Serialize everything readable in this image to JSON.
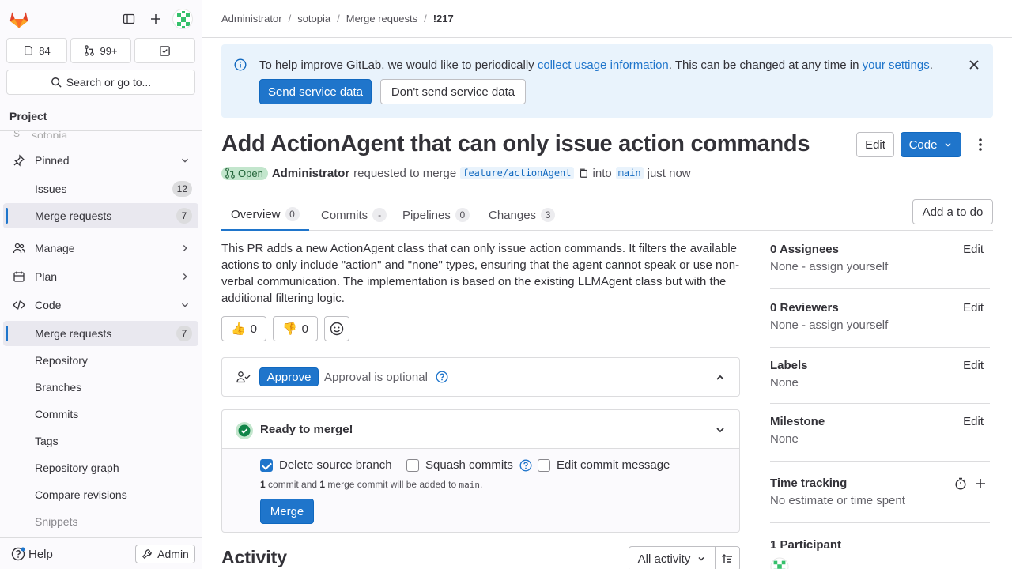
{
  "sidebar": {
    "counts": {
      "issues": "84",
      "merge_requests": "99+"
    },
    "search_label": "Search or go to...",
    "section_title": "Project",
    "project_name": "sotopia",
    "project_initial": "S",
    "pinned": "Pinned",
    "pinned_items": [
      {
        "label": "Issues",
        "badge": "12"
      },
      {
        "label": "Merge requests",
        "badge": "7"
      }
    ],
    "groups": {
      "manage": "Manage",
      "plan": "Plan",
      "code": "Code"
    },
    "code_items": [
      {
        "label": "Merge requests",
        "badge": "7"
      },
      {
        "label": "Repository"
      },
      {
        "label": "Branches"
      },
      {
        "label": "Commits"
      },
      {
        "label": "Tags"
      },
      {
        "label": "Repository graph"
      },
      {
        "label": "Compare revisions"
      },
      {
        "label": "Snippets"
      }
    ],
    "help": "Help",
    "admin": "Admin"
  },
  "breadcrumb": [
    "Administrator",
    "sotopia",
    "Merge requests",
    "!217"
  ],
  "alert": {
    "text_before": "To help improve GitLab, we would like to periodically ",
    "link1": "collect usage information",
    "text_middle": ". This can be changed at any time in ",
    "link2": "your settings",
    "text_after": ".",
    "send": "Send service data",
    "dont_send": "Don't send service data"
  },
  "mr": {
    "title": "Add ActionAgent that can only issue action commands",
    "edit": "Edit",
    "code": "Code",
    "status": "Open",
    "author": "Administrator",
    "requested": "requested to merge",
    "source_branch": "feature/actionAgent",
    "into": "into",
    "target_branch": "main",
    "time": "just now"
  },
  "tabs": [
    {
      "label": "Overview",
      "count": "0"
    },
    {
      "label": "Commits",
      "count": "-"
    },
    {
      "label": "Pipelines",
      "count": "0"
    },
    {
      "label": "Changes",
      "count": "3"
    }
  ],
  "add_todo": "Add a to do",
  "description": "This PR adds a new ActionAgent class that can only issue action commands. It filters the available actions to only include \"action\" and \"none\" types, ensuring that the agent cannot speak or use non-verbal communication. The implementation is based on the existing LLMAgent class but with the additional filtering logic.",
  "reactions": {
    "thumbs_up": "0",
    "thumbs_down": "0"
  },
  "approval": {
    "button": "Approve",
    "text": "Approval is optional"
  },
  "merge": {
    "status": "Ready to merge!",
    "delete_source": "Delete source branch",
    "squash": "Squash commits",
    "edit_message": "Edit commit message",
    "note_n1": "1",
    "note_a": " commit and ",
    "note_n2": "1",
    "note_b": " merge commit will be added to ",
    "note_branch": "main",
    "note_end": ".",
    "button": "Merge"
  },
  "activity": {
    "title": "Activity",
    "filter": "All activity"
  },
  "right": {
    "edit": "Edit",
    "assignees_h": "0 Assignees",
    "assignees_v": "None - assign yourself",
    "reviewers_h": "0 Reviewers",
    "reviewers_v": "None - assign yourself",
    "labels_h": "Labels",
    "labels_v": "None",
    "milestone_h": "Milestone",
    "milestone_v": "None",
    "time_h": "Time tracking",
    "time_v": "No estimate or time spent",
    "participants_h": "1 Participant"
  },
  "colors": {
    "accent": "#1f75cb",
    "open_badge": "#c3e6cd",
    "alert_bg": "#e9f3fc",
    "success": "#108548"
  }
}
